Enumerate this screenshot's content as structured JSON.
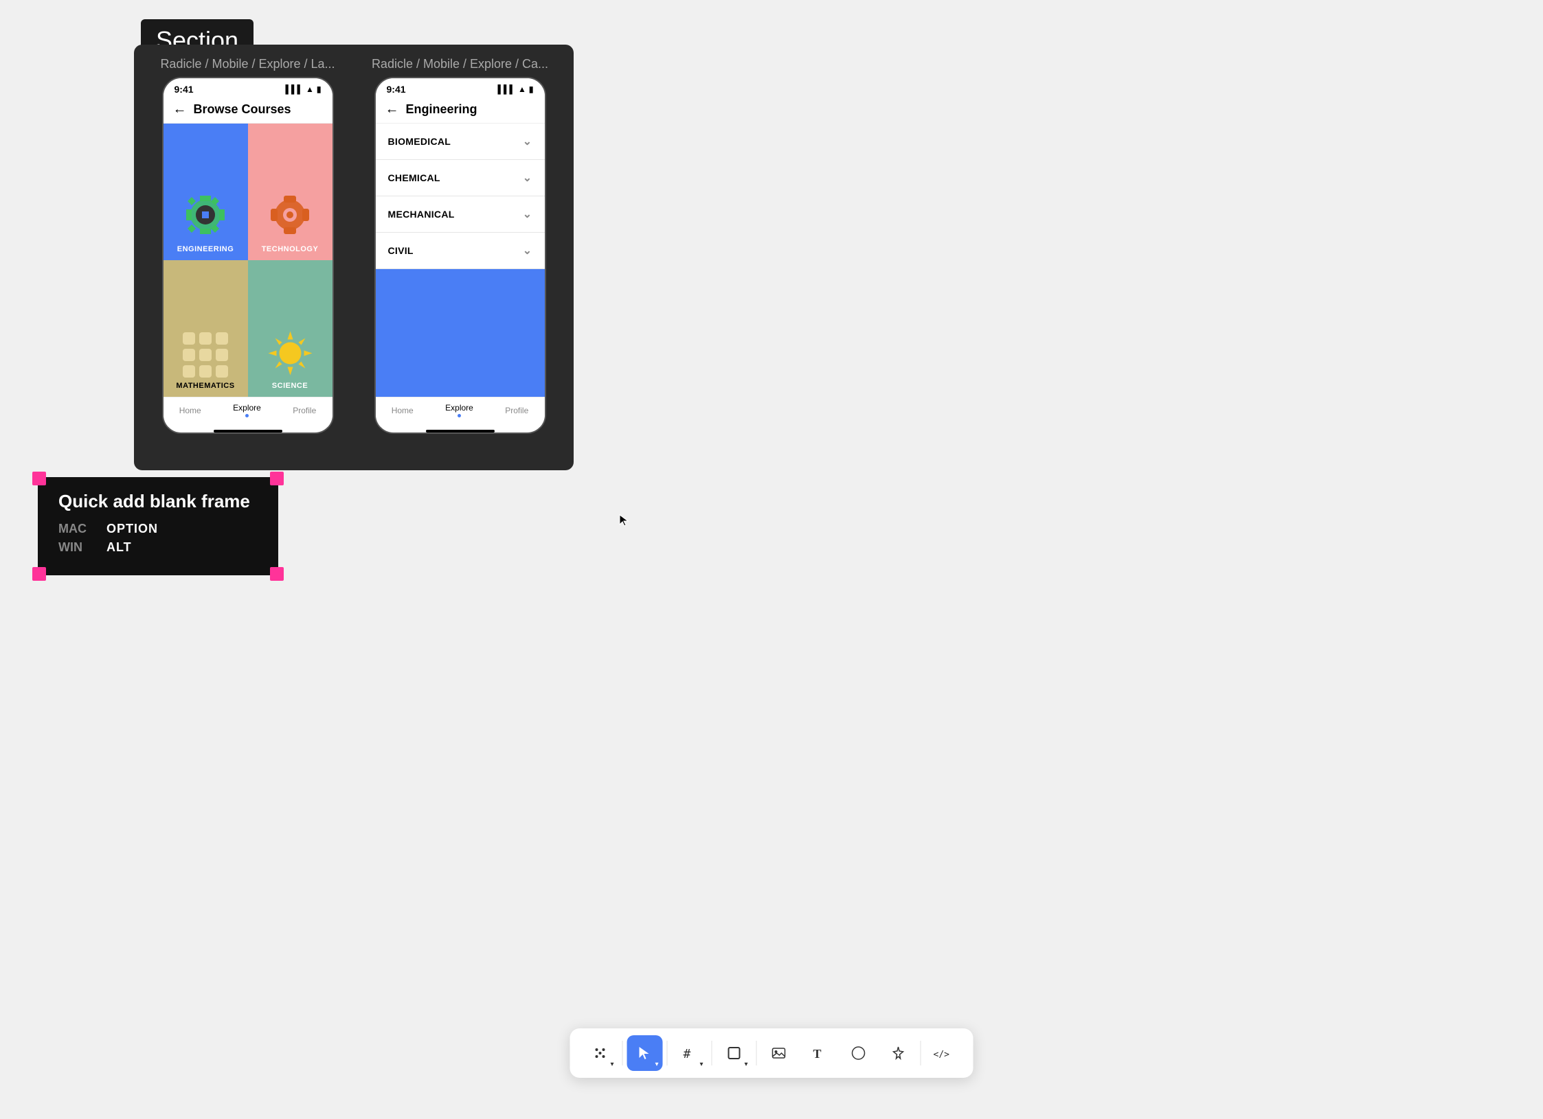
{
  "section": {
    "label": "Section"
  },
  "canvas": {
    "phone1": {
      "breadcrumb": "Radicle / Mobile / Explore / La...",
      "status_time": "9:41",
      "header_title": "Browse Courses",
      "tiles": [
        {
          "id": "engineering",
          "label": "ENGINEERING",
          "bg": "engineering"
        },
        {
          "id": "technology",
          "label": "TECHNOLOGY",
          "bg": "technology"
        },
        {
          "id": "mathematics",
          "label": "MATHEMATICS",
          "bg": "mathematics"
        },
        {
          "id": "science",
          "label": "SCIENCE",
          "bg": "science"
        }
      ],
      "nav": {
        "items": [
          "Home",
          "Explore",
          "Profile"
        ],
        "active": "Explore"
      }
    },
    "phone2": {
      "breadcrumb": "Radicle / Mobile / Explore / Ca...",
      "status_time": "9:41",
      "header_title": "Engineering",
      "items": [
        {
          "label": "BIOMEDICAL"
        },
        {
          "label": "CHEMICAL"
        },
        {
          "label": "MECHANICAL"
        },
        {
          "label": "CIVIL"
        }
      ],
      "nav": {
        "items": [
          "Home",
          "Explore",
          "Profile"
        ],
        "active": "Explore"
      }
    }
  },
  "tooltip": {
    "title": "Quick add blank frame",
    "shortcuts": [
      {
        "platform": "MAC",
        "key": "OPTION"
      },
      {
        "platform": "WIN",
        "key": "ALT"
      }
    ]
  },
  "toolbar": {
    "buttons": [
      {
        "id": "select",
        "icon": "⊹",
        "active": false,
        "dropdown": true
      },
      {
        "id": "pointer",
        "icon": "↖",
        "active": true,
        "dropdown": true
      },
      {
        "id": "frame",
        "icon": "#",
        "active": false,
        "dropdown": true
      },
      {
        "id": "shape",
        "icon": "□",
        "active": false,
        "dropdown": true
      },
      {
        "id": "image",
        "icon": "⊞",
        "active": false,
        "dropdown": false
      },
      {
        "id": "text",
        "icon": "T",
        "active": false,
        "dropdown": false
      },
      {
        "id": "chat",
        "icon": "○",
        "active": false,
        "dropdown": false
      },
      {
        "id": "pen",
        "icon": "✦",
        "active": false,
        "dropdown": false
      },
      {
        "id": "code",
        "icon": "</>",
        "active": false,
        "dropdown": false
      }
    ]
  }
}
